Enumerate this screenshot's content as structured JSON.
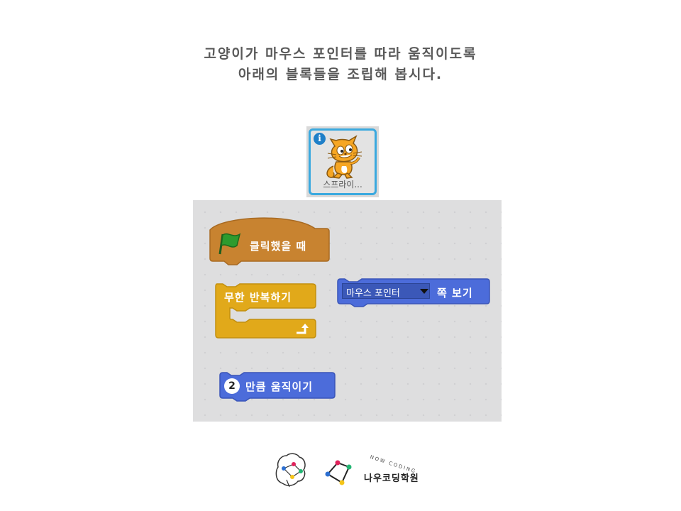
{
  "instructions": {
    "line1": "고양이가 마우스 포인터를 따라 움직이도록",
    "line2": "아래의 블록들을 조립해 봅시다."
  },
  "sprite": {
    "label": "스프라이...",
    "info_icon": "i"
  },
  "blocks": {
    "when_flag_clicked": "클릭했을 때",
    "forever": "무한 반복하기",
    "point_towards_dropdown": "마우스 포인터",
    "point_towards_label": "쪽 보기",
    "move_steps_value": "2",
    "move_steps_label": "만큼 움직이기"
  },
  "footer": {
    "brand_name": "나우코딩학원",
    "brand_tagline": "NOW CODING"
  },
  "colors": {
    "events": "#c88330",
    "control": "#e1a91a",
    "motion": "#4c6cda",
    "flag": "#2e8b2e",
    "sprite_border": "#3aa9df"
  },
  "icons": [
    "info-icon",
    "cat-sprite-icon",
    "green-flag-icon",
    "dropdown-arrow-icon",
    "loop-arrow-icon",
    "brain-logo-icon",
    "graph-logo-icon"
  ]
}
